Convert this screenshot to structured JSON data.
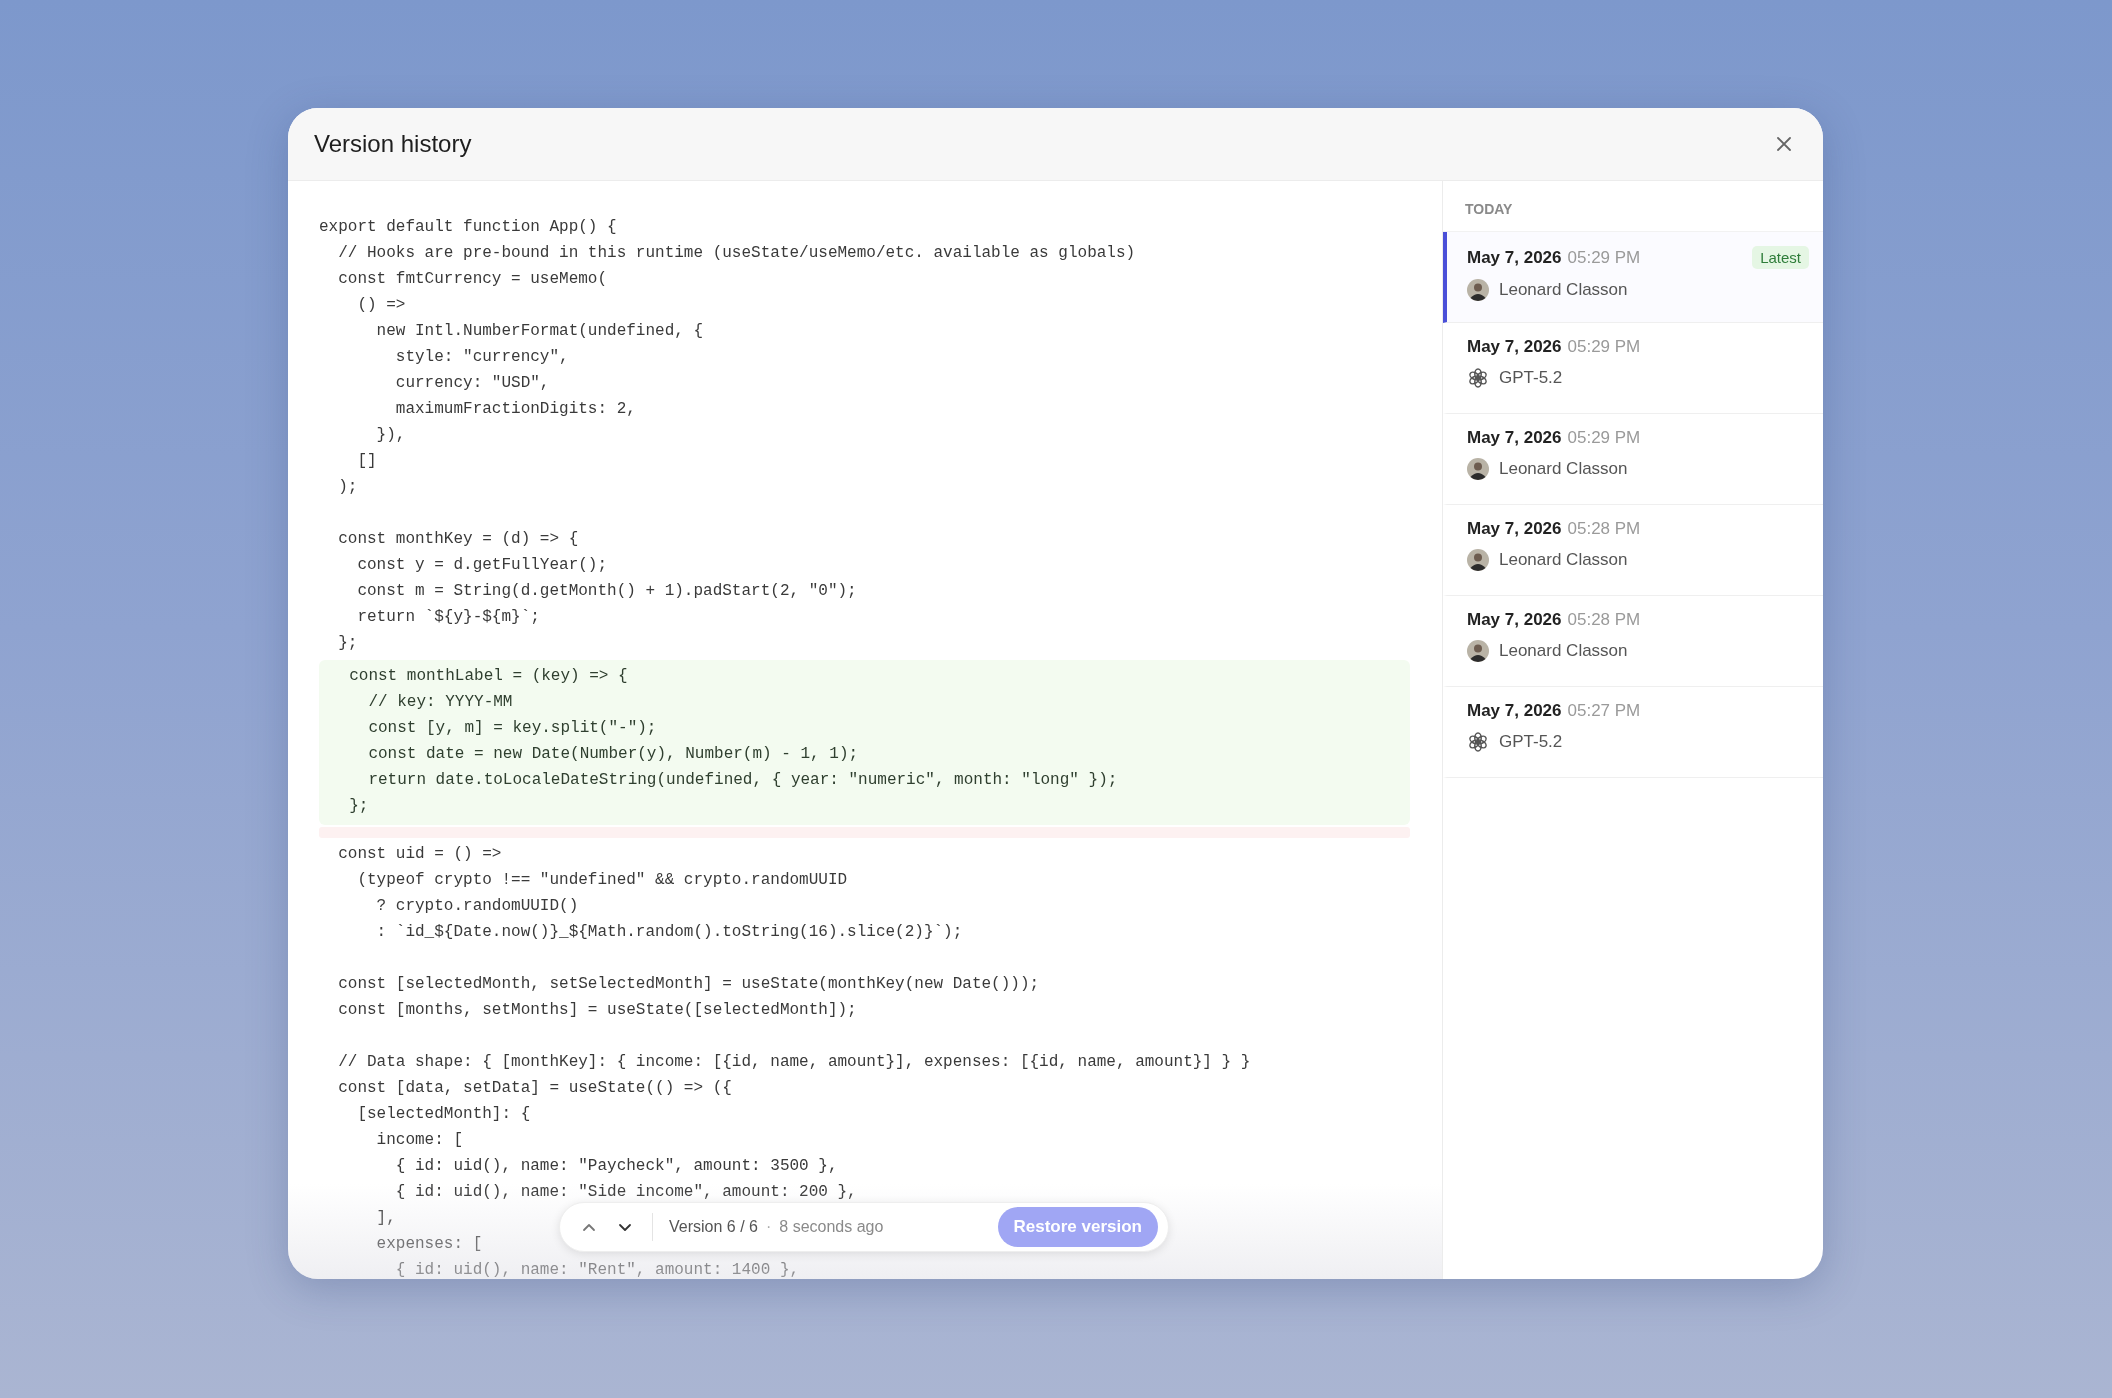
{
  "dialog": {
    "title": "Version history"
  },
  "code": {
    "blocks": [
      {
        "kind": "plain",
        "lines": [
          "export default function App() {",
          "  // Hooks are pre-bound in this runtime (useState/useMemo/etc. available as globals)",
          "  const fmtCurrency = useMemo(",
          "    () =>",
          "      new Intl.NumberFormat(undefined, {",
          "        style: \"currency\",",
          "        currency: \"USD\",",
          "        maximumFractionDigits: 2,",
          "      }),",
          "    []",
          "  );"
        ]
      },
      {
        "kind": "plain",
        "lines": [
          "  const monthKey = (d) => {",
          "    const y = d.getFullYear();",
          "    const m = String(d.getMonth() + 1).padStart(2, \"0\");",
          "    return `${y}-${m}`;",
          "  };"
        ]
      },
      {
        "kind": "added",
        "lines": [
          "  const monthLabel = (key) => {",
          "    // key: YYYY-MM",
          "    const [y, m] = key.split(\"-\");",
          "    const date = new Date(Number(y), Number(m) - 1, 1);",
          "    return date.toLocaleDateString(undefined, { year: \"numeric\", month: \"long\" });",
          "  };"
        ]
      },
      {
        "kind": "removed"
      },
      {
        "kind": "plain",
        "lines": [
          "  const uid = () =>",
          "    (typeof crypto !== \"undefined\" && crypto.randomUUID",
          "      ? crypto.randomUUID()",
          "      : `id_${Date.now()}_${Math.random().toString(16).slice(2)}`);"
        ]
      },
      {
        "kind": "plain",
        "lines": [
          "  const [selectedMonth, setSelectedMonth] = useState(monthKey(new Date()));",
          "  const [months, setMonths] = useState([selectedMonth]);"
        ]
      },
      {
        "kind": "plain",
        "lines": [
          "  // Data shape: { [monthKey]: { income: [{id, name, amount}], expenses: [{id, name, amount}] } }",
          "  const [data, setData] = useState(() => ({",
          "    [selectedMonth]: {",
          "      income: [",
          "        { id: uid(), name: \"Paycheck\", amount: 3500 },",
          "        { id: uid(), name: \"Side income\", amount: 200 },",
          "      ],",
          "      expenses: [",
          "        { id: uid(), name: \"Rent\", amount: 1400 },"
        ]
      }
    ]
  },
  "history": {
    "group": "TODAY",
    "items": [
      {
        "date": "May 7, 2026",
        "time": "05:29 PM",
        "author": "Leonard Classon",
        "kind": "person",
        "badge": "Latest",
        "selected": true
      },
      {
        "date": "May 7, 2026",
        "time": "05:29 PM",
        "author": "GPT-5.2",
        "kind": "ai",
        "selected": false
      },
      {
        "date": "May 7, 2026",
        "time": "05:29 PM",
        "author": "Leonard Classon",
        "kind": "person",
        "selected": false
      },
      {
        "date": "May 7, 2026",
        "time": "05:28 PM",
        "author": "Leonard Classon",
        "kind": "person",
        "selected": false
      },
      {
        "date": "May 7, 2026",
        "time": "05:28 PM",
        "author": "Leonard Classon",
        "kind": "person",
        "selected": false
      },
      {
        "date": "May 7, 2026",
        "time": "05:27 PM",
        "author": "GPT-5.2",
        "kind": "ai",
        "selected": false
      }
    ]
  },
  "footer": {
    "version": "Version 6 / 6",
    "separator": "·",
    "age": "8 seconds ago",
    "restore_button": {
      "label": "Restore version",
      "disabled": true
    }
  }
}
